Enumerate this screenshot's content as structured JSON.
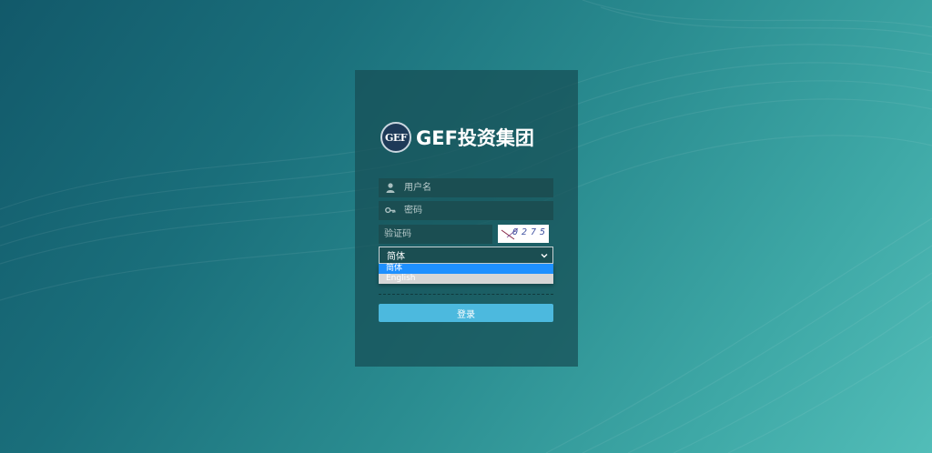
{
  "logo": {
    "emblem_text": "GEF",
    "brand_text": "GEF投资集团"
  },
  "login_form": {
    "username_placeholder": "用户名",
    "password_placeholder": "密码",
    "captcha_placeholder": "验证码",
    "captcha_code": "0275",
    "language": {
      "selected": "简体",
      "options": [
        "简体",
        "English"
      ]
    },
    "submit_label": "登录"
  },
  "icons": {
    "username": "user-icon",
    "password": "key-icon",
    "select": "chevron-down-icon"
  },
  "colors": {
    "panel": "#164e54",
    "input_bg": "#1b4e52",
    "button": "#4cb9de",
    "dropdown_selected": "#1e90ff"
  }
}
